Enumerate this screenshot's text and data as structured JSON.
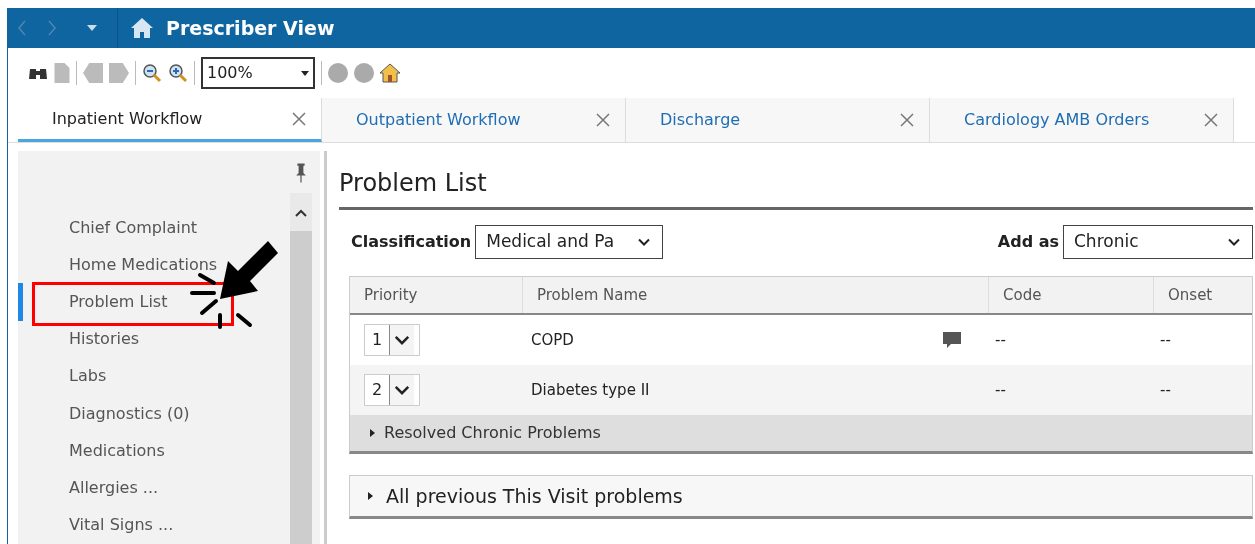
{
  "header": {
    "title": "Prescriber View"
  },
  "toolbar": {
    "zoom": "100%"
  },
  "tabs": [
    {
      "label": "Inpatient Workflow",
      "selected": true
    },
    {
      "label": "Outpatient Workflow",
      "selected": false
    },
    {
      "label": "Discharge",
      "selected": false
    },
    {
      "label": "Cardiology AMB Orders",
      "selected": false
    }
  ],
  "sidebar": {
    "items": [
      {
        "label": "Chief Complaint",
        "selected": false,
        "highlighted": false
      },
      {
        "label": "Home Medications",
        "selected": false,
        "highlighted": false
      },
      {
        "label": "Problem List",
        "selected": true,
        "highlighted": true
      },
      {
        "label": "Histories",
        "selected": false,
        "highlighted": false
      },
      {
        "label": "Labs",
        "selected": false,
        "highlighted": false
      },
      {
        "label": "Diagnostics (0)",
        "selected": false,
        "highlighted": false
      },
      {
        "label": "Medications",
        "selected": false,
        "highlighted": false
      },
      {
        "label": "Allergies ...",
        "selected": false,
        "highlighted": false
      },
      {
        "label": "Vital Signs ...",
        "selected": false,
        "highlighted": false
      }
    ]
  },
  "panel": {
    "title": "Problem List",
    "classification_label": "Classification",
    "classification_value": "Medical and Pa",
    "add_as_label": "Add as",
    "add_as_value": "Chronic",
    "table": {
      "columns": [
        "Priority",
        "Problem Name",
        "Code",
        "Onset"
      ],
      "rows": [
        {
          "priority": "1",
          "name": "COPD",
          "has_comment": true,
          "code": "--",
          "onset": "--"
        },
        {
          "priority": "2",
          "name": "Diabetes type II",
          "has_comment": false,
          "code": "--",
          "onset": "--"
        }
      ],
      "group": {
        "label": "Resolved Chronic Problems",
        "expanded": false
      }
    },
    "previous": {
      "label": "All previous This Visit problems",
      "expanded": false
    }
  }
}
